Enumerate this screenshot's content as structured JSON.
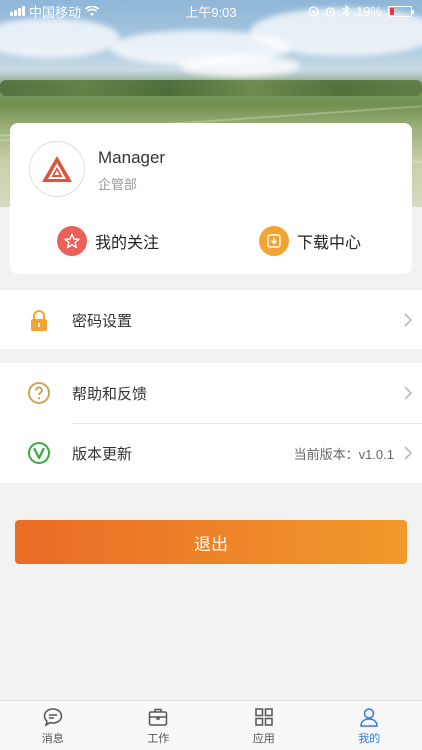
{
  "status_bar": {
    "carrier": "中国移动",
    "time": "上午9:03",
    "battery": "19%",
    "battery_level": 0.19
  },
  "profile": {
    "name": "Manager",
    "department": "企管部"
  },
  "quick_actions": [
    {
      "label": "我的关注",
      "icon": "star-icon",
      "color": "#e8625a"
    },
    {
      "label": "下载中心",
      "icon": "download-icon",
      "color": "#f2a430"
    }
  ],
  "menu": {
    "password": {
      "label": "密码设置",
      "icon": "lock-icon"
    },
    "help": {
      "label": "帮助和反馈",
      "icon": "question-icon"
    },
    "update": {
      "label": "版本更新",
      "icon": "version-icon",
      "value": "当前版本：v1.0.1"
    }
  },
  "logout_label": "退出",
  "tabs": [
    {
      "label": "消息",
      "icon": "message-icon",
      "active": false
    },
    {
      "label": "工作",
      "icon": "briefcase-icon",
      "active": false
    },
    {
      "label": "应用",
      "icon": "grid-icon",
      "active": false
    },
    {
      "label": "我的",
      "icon": "person-icon",
      "active": true
    }
  ],
  "colors": {
    "accent": "#2b7de9",
    "logout_start": "#ea6b25",
    "logout_end": "#f09a2c"
  }
}
